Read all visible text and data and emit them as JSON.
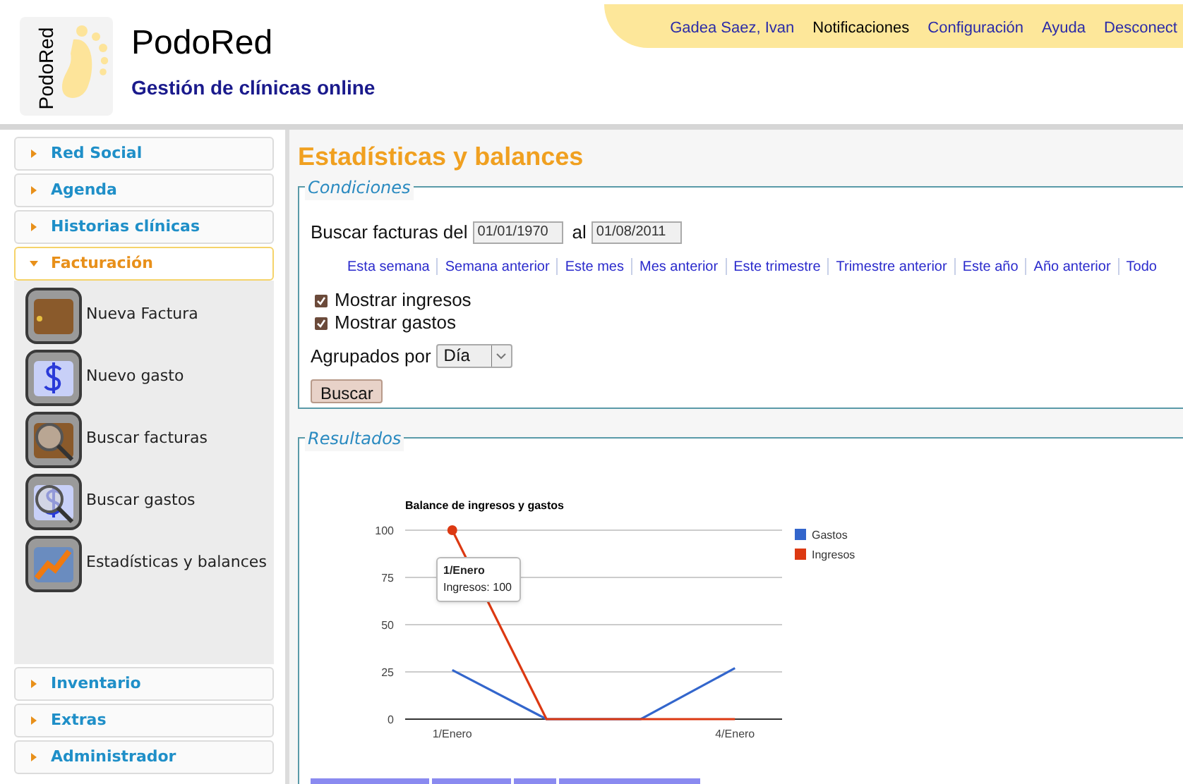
{
  "header": {
    "logo_text": "PodoRed",
    "app_name": "PodoRed",
    "tagline": "Gestión de clínicas online",
    "links": [
      {
        "label": "Gadea Saez, Ivan",
        "kind": "link"
      },
      {
        "label": "Notificaciones",
        "kind": "text"
      },
      {
        "label": "Configuración",
        "kind": "link"
      },
      {
        "label": "Ayuda",
        "kind": "link"
      },
      {
        "label": "Desconect",
        "kind": "link"
      }
    ]
  },
  "sidebar": {
    "sections": [
      {
        "label": "Red Social",
        "expanded": false
      },
      {
        "label": "Agenda",
        "expanded": false
      },
      {
        "label": "Historias clínicas",
        "expanded": false
      },
      {
        "label": "Facturación",
        "expanded": true,
        "items": [
          {
            "label": "Nueva Factura",
            "kind": "wallet"
          },
          {
            "label": "Nuevo gasto",
            "kind": "dollar"
          },
          {
            "label": "Buscar facturas",
            "kind": "search-wallet"
          },
          {
            "label": "Buscar gastos",
            "kind": "search-dollar"
          },
          {
            "label": "Estadísticas y balances",
            "kind": "chart"
          }
        ]
      },
      {
        "label": "Inventario",
        "expanded": false
      },
      {
        "label": "Extras",
        "expanded": false
      },
      {
        "label": "Administrador",
        "expanded": false
      }
    ]
  },
  "main": {
    "title": "Estadísticas y balances",
    "conditions": {
      "legend": "Condiciones",
      "date_label": "Buscar facturas del",
      "from": "01/01/1970",
      "to_label": "al",
      "to": "01/08/2011",
      "quick_ranges": [
        "Esta semana",
        "Semana anterior",
        "Este mes",
        "Mes anterior",
        "Este trimestre",
        "Trimestre anterior",
        "Este año",
        "Año anterior",
        "Todo"
      ],
      "checkboxes": [
        {
          "label": "Mostrar ingresos",
          "checked": true
        },
        {
          "label": "Mostrar gastos",
          "checked": true
        }
      ],
      "group_label": "Agrupados por",
      "group_value": "Día",
      "button": "Buscar"
    },
    "results": {
      "legend": "Resultados",
      "tooltip": {
        "title": "1/Enero",
        "text": "Ingresos: 100"
      },
      "chart_data": {
        "type": "line",
        "title": "Balance de ingresos y gastos",
        "x": [
          1,
          2,
          3,
          4
        ],
        "xticks": [
          {
            "value": 1,
            "label": "1/Enero"
          },
          {
            "value": 4,
            "label": "4/Enero"
          }
        ],
        "xlim": [
          0.5,
          4.5
        ],
        "yticks": [
          0,
          25,
          50,
          75,
          100
        ],
        "ylim": [
          0,
          100
        ],
        "grid": true,
        "legend": true,
        "series": [
          {
            "name": "Gastos",
            "color": "#3366cc",
            "values": [
              26,
              0,
              0,
              27
            ]
          },
          {
            "name": "Ingresos",
            "color": "#dc3912",
            "values": [
              100,
              0,
              0,
              0
            ]
          }
        ]
      }
    }
  }
}
